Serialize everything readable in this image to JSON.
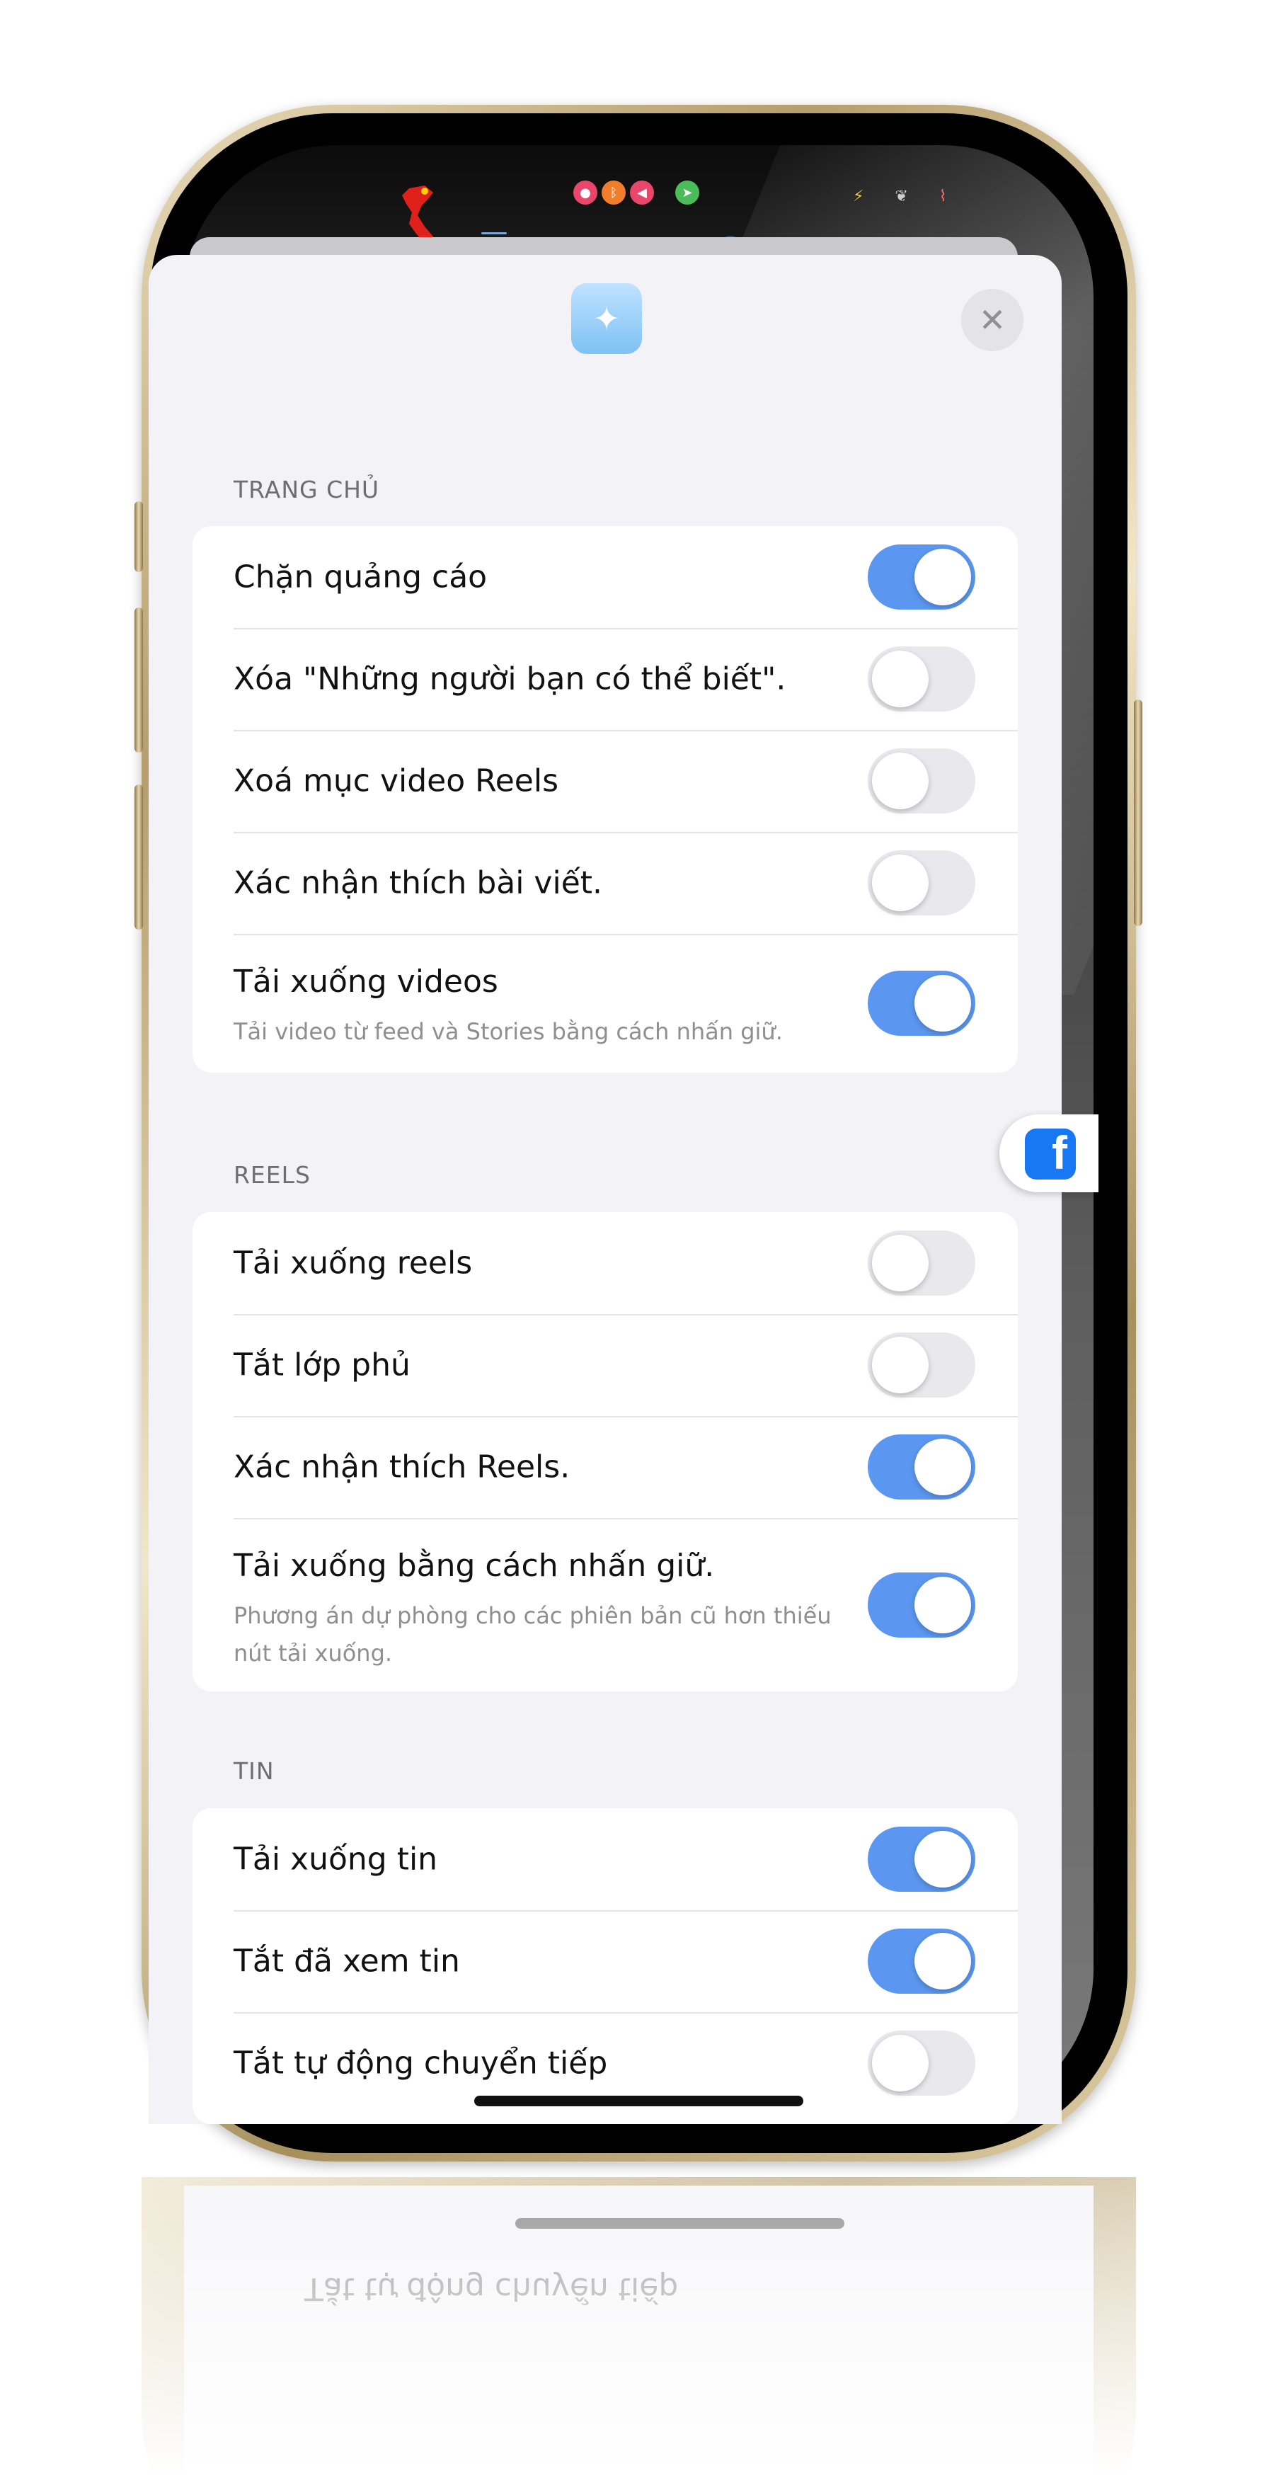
{
  "status_bar": {
    "left_icons": [
      "vietnam-map-icon"
    ],
    "center_icons": [
      "lock-icon",
      "bluetooth-icon",
      "speaker-icon",
      "location-arrow-icon"
    ],
    "right_icons": [
      "bolt-icon",
      "leaf-icon",
      "thermometer-icon"
    ]
  },
  "sheet": {
    "app_icon": "sparkles-icon",
    "close_icon": "close-icon"
  },
  "sections": [
    {
      "header": "TRANG CHỦ",
      "rows": [
        {
          "label": "Chặn quảng cáo",
          "on": true
        },
        {
          "label": "Xóa \"Những người bạn có thể biết\".",
          "on": false
        },
        {
          "label": "Xoá mục video Reels",
          "on": false
        },
        {
          "label": "Xác nhận thích bài viết.",
          "on": false
        },
        {
          "label": "Tải xuống videos",
          "sub": "Tải video từ feed và Stories bằng cách nhấn giữ.",
          "on": true
        }
      ]
    },
    {
      "header": "REELS",
      "rows": [
        {
          "label": "Tải xuống reels",
          "on": false
        },
        {
          "label": "Tắt lớp phủ",
          "on": false
        },
        {
          "label": "Xác nhận thích Reels.",
          "on": true
        },
        {
          "label": "Tải xuống bằng cách nhấn giữ.",
          "sub": "Phương án dự phòng cho các phiên bản cũ hơn thiếu nút tải xuống.",
          "on": true
        }
      ]
    },
    {
      "header": "TIN",
      "rows": [
        {
          "label": "Tải xuống tin",
          "on": true
        },
        {
          "label": "Tắt đã xem tin",
          "on": true
        },
        {
          "label": "Tắt tự động chuyển tiếp",
          "on": false
        }
      ]
    }
  ],
  "floating_button": {
    "icon": "facebook-icon",
    "glyph": "f"
  },
  "reflection_text": "Tắt tự động chuyển tiếp"
}
